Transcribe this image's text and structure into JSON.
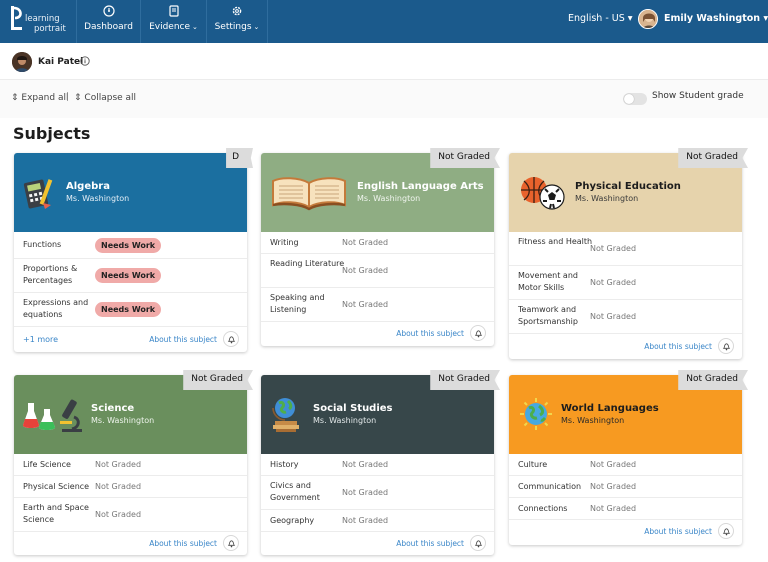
{
  "app": {
    "logo_text_1": "learning",
    "logo_text_2": "portrait"
  },
  "nav": {
    "items": [
      {
        "label": "Dashboard",
        "icon": "dashboard-icon"
      },
      {
        "label": "Evidence",
        "icon": "book-icon",
        "chevron": "⌄"
      },
      {
        "label": "Settings",
        "icon": "gear-icon",
        "chevron": "⌄"
      }
    ],
    "language": "English - US",
    "user_name": "Emily Washington",
    "caret": "▾"
  },
  "student": {
    "name": "Kai Patel"
  },
  "controls": {
    "expand_all": "Expand all",
    "separator": "|",
    "collapse_all": "Collapse all",
    "show_grade": "Show Student grade",
    "show_grade_on": false
  },
  "section_title": "Subjects",
  "colors": {
    "nav": "#1b5a8c",
    "algebra": "#1b6fa0",
    "ela": "#8fad83",
    "pe": "#e6d3ac",
    "science": "#6a8f5d",
    "social": "#37474a",
    "world": "#f79a21",
    "needs_work": "#f0aaa8",
    "link": "#3a86c8"
  },
  "cards": [
    {
      "title": "Algebra",
      "teacher": "Ms. Washington",
      "grade": "D",
      "icon": "calculator-icon",
      "rows": [
        {
          "name": "Functions",
          "status": "Needs Work"
        },
        {
          "name": "Proportions & Percentages",
          "status": "Needs Work"
        },
        {
          "name": "Expressions and equations",
          "status": "Needs Work"
        }
      ],
      "more": "+1 more",
      "about": "About this subject"
    },
    {
      "title": "English Language Arts",
      "teacher": "Ms. Washington",
      "grade": "Not Graded",
      "icon": "open-book-icon",
      "rows": [
        {
          "name": "Writing",
          "status": "Not Graded"
        },
        {
          "name": "Reading Literature",
          "status": "Not Graded"
        },
        {
          "name": "Speaking and Listening",
          "status": "Not Graded"
        }
      ],
      "about": "About this subject"
    },
    {
      "title": "Physical Education",
      "teacher": "Ms. Washington",
      "grade": "Not Graded",
      "icon": "sports-balls-icon",
      "rows": [
        {
          "name": "Fitness and Health",
          "status": "Not Graded"
        },
        {
          "name": "Movement and Motor Skills",
          "status": "Not Graded"
        },
        {
          "name": "Teamwork and Sportsmanship",
          "status": "Not Graded"
        }
      ],
      "about": "About this subject"
    },
    {
      "title": "Science",
      "teacher": "Ms. Washington",
      "grade": "Not Graded",
      "icon": "microscope-icon",
      "rows": [
        {
          "name": "Life Science",
          "status": "Not Graded"
        },
        {
          "name": "Physical Science",
          "status": "Not Graded"
        },
        {
          "name": "Earth and Space Science",
          "status": "Not Graded"
        }
      ],
      "about": "About this subject"
    },
    {
      "title": "Social Studies",
      "teacher": "Ms. Washington",
      "grade": "Not Graded",
      "icon": "globe-books-icon",
      "rows": [
        {
          "name": "History",
          "status": "Not Graded"
        },
        {
          "name": "Civics and Government",
          "status": "Not Graded"
        },
        {
          "name": "Geography",
          "status": "Not Graded"
        }
      ],
      "about": "About this subject"
    },
    {
      "title": "World Languages",
      "teacher": "Ms. Washington",
      "grade": "Not Graded",
      "icon": "world-globe-icon",
      "rows": [
        {
          "name": "Culture",
          "status": "Not Graded"
        },
        {
          "name": "Communication",
          "status": "Not Graded"
        },
        {
          "name": "Connections",
          "status": "Not Graded"
        }
      ],
      "about": "About this subject"
    }
  ]
}
